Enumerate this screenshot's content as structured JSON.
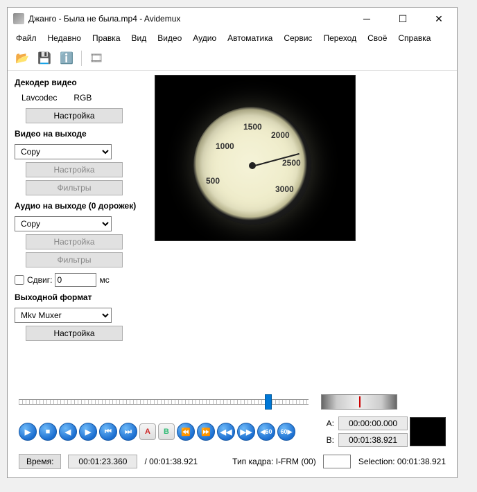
{
  "window": {
    "title": "Джанго - Была не была.mp4 - Avidemux"
  },
  "menu": [
    "Файл",
    "Недавно",
    "Правка",
    "Вид",
    "Видео",
    "Аудио",
    "Автоматика",
    "Сервис",
    "Переход",
    "Своё",
    "Справка"
  ],
  "toolbar_icons": [
    "open-icon",
    "save-icon",
    "info-icon",
    "calc-icon"
  ],
  "decoder": {
    "title": "Декодер видео",
    "codec": "Lavcodec",
    "colorspace": "RGB",
    "settings_btn": "Настройка"
  },
  "video_out": {
    "title": "Видео на выходе",
    "selected": "Copy",
    "settings_btn": "Настройка",
    "filters_btn": "Фильтры"
  },
  "audio_out": {
    "title": "Аудио на выходе (0 дорожек)",
    "selected": "Copy",
    "settings_btn": "Настройка",
    "filters_btn": "Фильтры",
    "shift_label": "Сдвиг:",
    "shift_value": 0,
    "shift_unit": "мс"
  },
  "output_format": {
    "title": "Выходной формат",
    "selected": "Mkv Muxer",
    "settings_btn": "Настройка"
  },
  "gauge_labels": [
    "500",
    "1000",
    "1500",
    "2000",
    "2500",
    "3000"
  ],
  "ab": {
    "a_label": "A:",
    "a_time": "00:00:00.000",
    "b_label": "B:",
    "b_time": "00:01:38.921",
    "selection_label": "Selection: 00:01:38.921"
  },
  "bottom": {
    "time_label": "Время:",
    "current_time": "00:01:23.360",
    "total_time": "/ 00:01:38.921",
    "frame_type_label": "Тип кадра:  I-FRM (00)",
    "frame_value": ""
  }
}
